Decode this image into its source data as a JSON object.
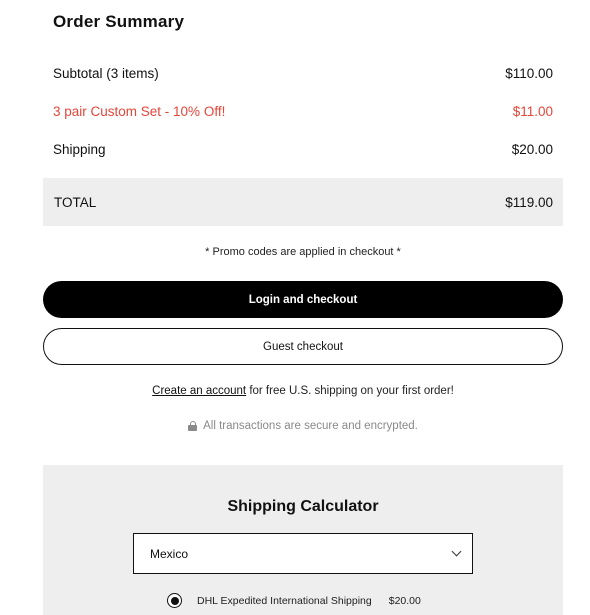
{
  "summary": {
    "title": "Order Summary",
    "subtotal_label": "Subtotal (3 items)",
    "subtotal_value": "$110.00",
    "discount_label": "3 pair Custom Set - 10% Off!",
    "discount_value": "$11.00",
    "shipping_label": "Shipping",
    "shipping_value": "$20.00",
    "total_label": "TOTAL",
    "total_value": "$119.00",
    "promo_note": "* Promo codes are applied in checkout *"
  },
  "actions": {
    "login_checkout": "Login and checkout",
    "guest_checkout": "Guest checkout",
    "create_account_link": "Create an account",
    "create_account_rest": " for free U.S. shipping on your first order!",
    "secure_note": "All transactions are secure and encrypted."
  },
  "calculator": {
    "title": "Shipping Calculator",
    "country_selected": "Mexico",
    "option_label": "DHL Expedited International Shipping",
    "option_price": "$20.00",
    "option_selected": true
  },
  "colors": {
    "discount": "#e5463a",
    "panel": "#eeeeee",
    "primary_button": "#000000"
  }
}
